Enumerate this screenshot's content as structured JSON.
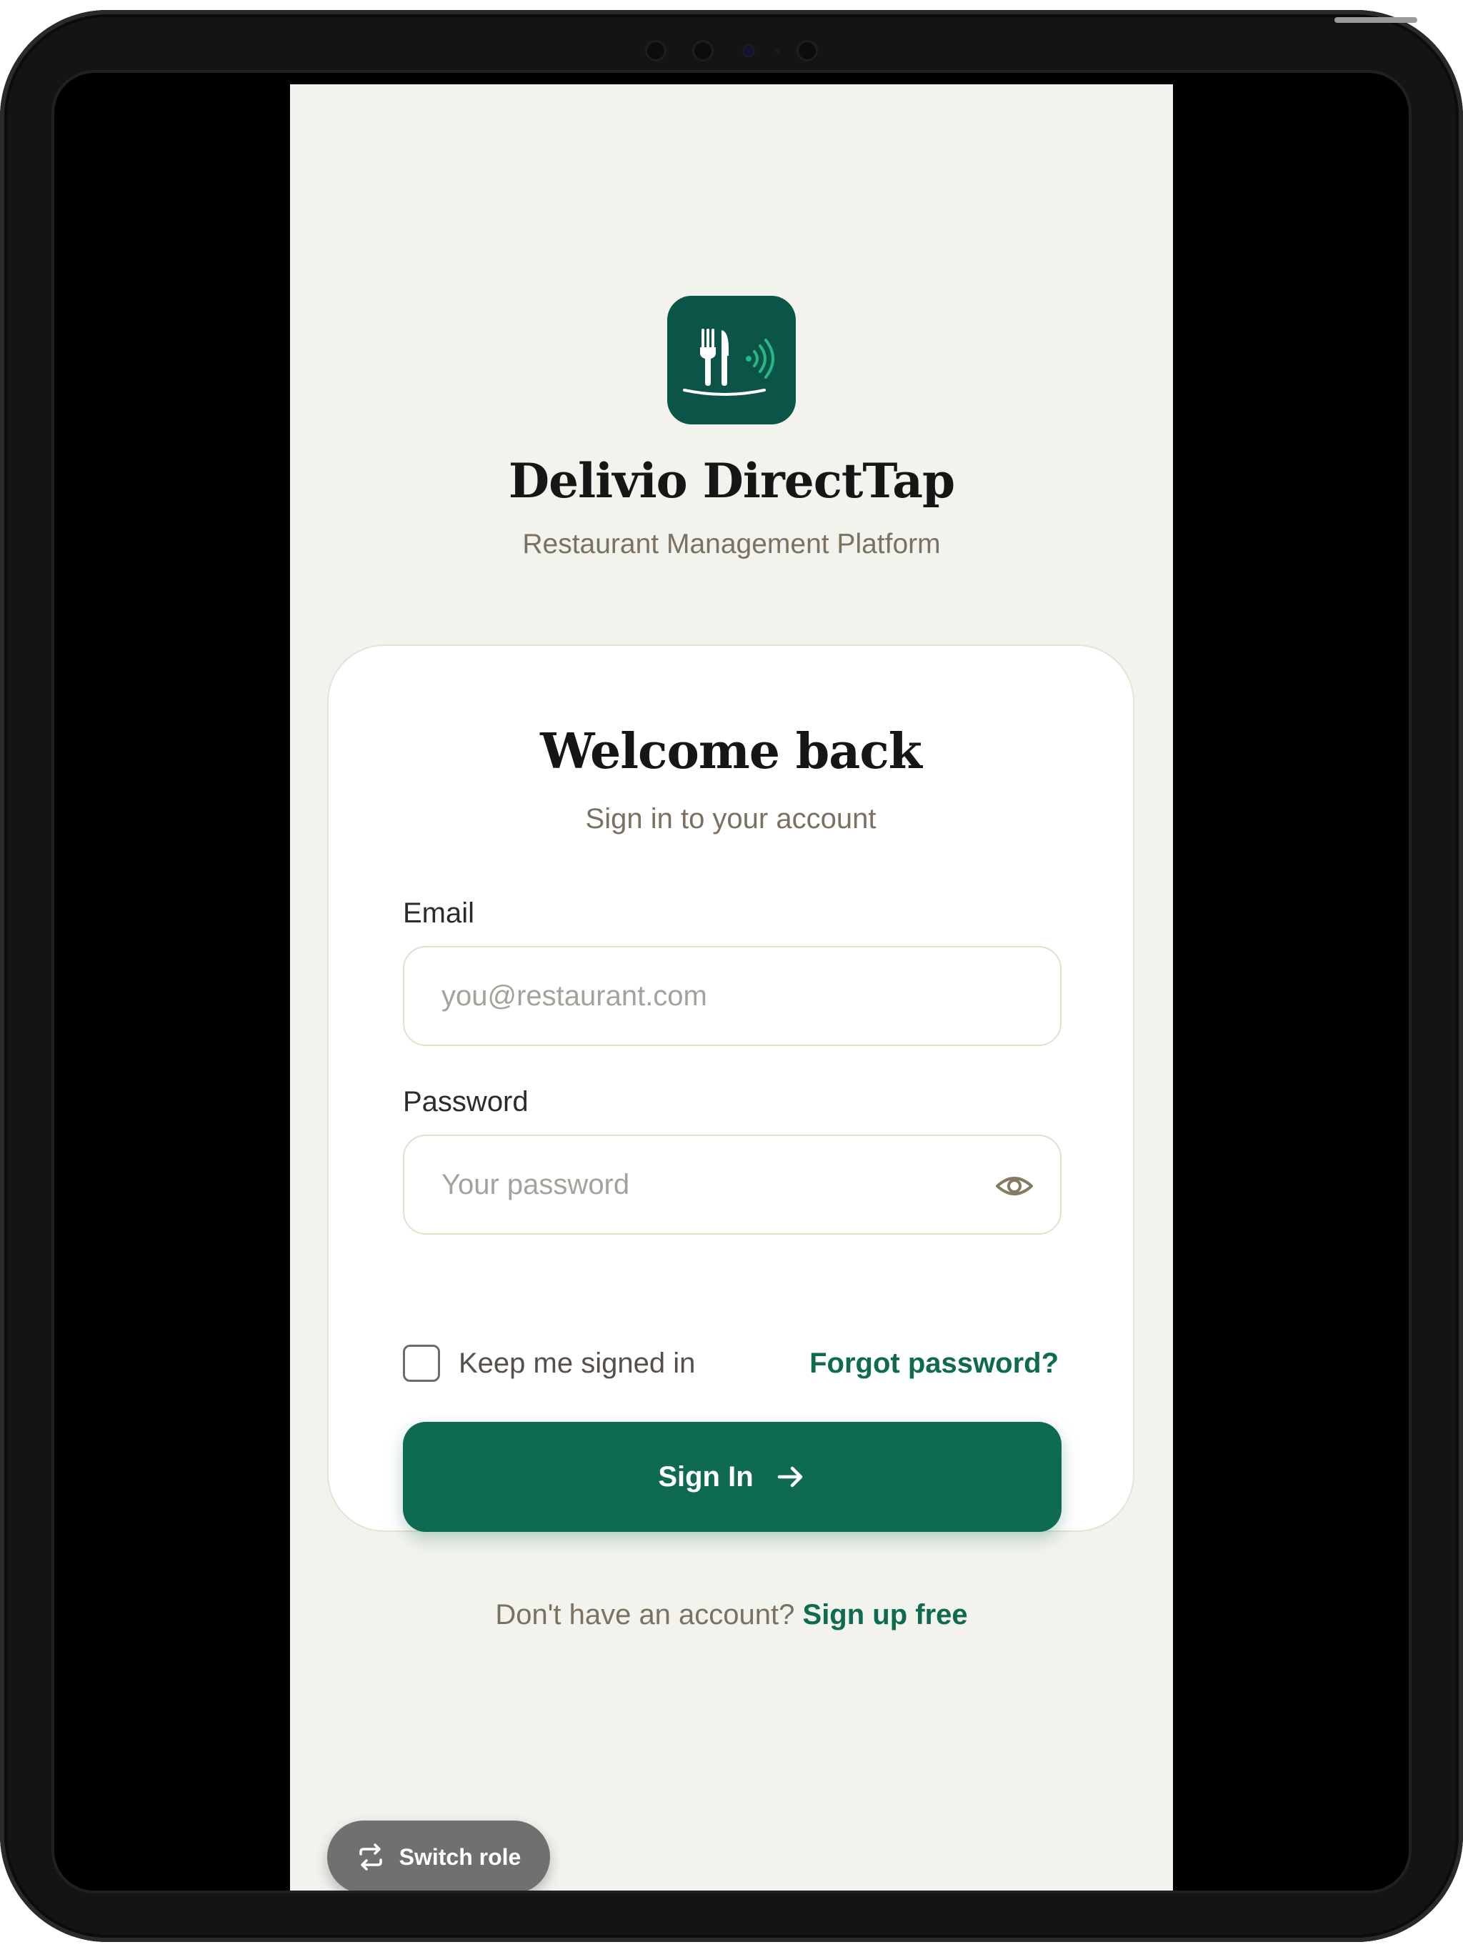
{
  "app": {
    "name": "Delivio DirectTap",
    "tagline": "Restaurant Management Platform",
    "logo_icon": "fork-knife-tap-icon",
    "brand_color": "#0b5447",
    "accent_color": "#0e6b51"
  },
  "login": {
    "title": "Welcome back",
    "subtitle": "Sign in to your account",
    "email_label": "Email",
    "email_placeholder": "you@restaurant.com",
    "email_value": "",
    "password_label": "Password",
    "password_placeholder": "Your password",
    "password_value": "",
    "password_toggle_icon": "eye-icon",
    "remember_label": "Keep me signed in",
    "remember_checked": false,
    "forgot_label": "Forgot password?",
    "submit_label": "Sign In",
    "submit_icon": "arrow-right-icon"
  },
  "footer": {
    "prompt": "Don't have an account?",
    "signup_label": "Sign up free"
  },
  "switch_role": {
    "label": "Switch role",
    "icon": "swap-arrows-icon"
  }
}
